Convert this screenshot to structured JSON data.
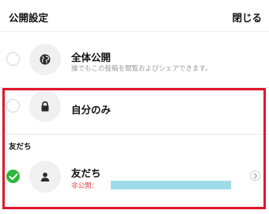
{
  "header": {
    "title": "公開設定",
    "close_label": "閉じる"
  },
  "options": [
    {
      "title": "全体公開",
      "description": "誰でもこの投稿を閲覧およびシェアできます。",
      "icon": "globe-icon",
      "selected": false
    },
    {
      "title": "自分のみ",
      "icon": "lock-icon",
      "selected": false
    }
  ],
  "friends_section": {
    "label": "友だち",
    "option": {
      "title": "友だち",
      "sub_label": "非公開：",
      "icon": "person-icon",
      "selected": true
    }
  },
  "colors": {
    "selected": "#2fb63c",
    "highlight_border": "#e0162b",
    "sub_label": "#e5484d",
    "redacted": "#9fdcea"
  }
}
